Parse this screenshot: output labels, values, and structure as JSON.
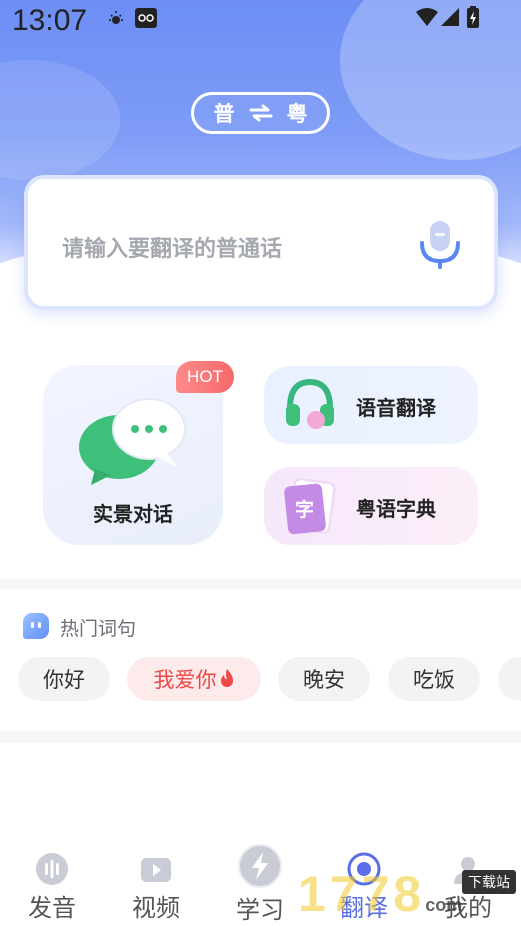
{
  "status_bar": {
    "time": "13:07"
  },
  "header": {
    "lang_from": "普",
    "lang_to": "粤",
    "swap_icon": "swap-arrows-icon"
  },
  "input": {
    "placeholder": "请输入要翻译的普通话",
    "mic_icon": "microphone-icon"
  },
  "features": {
    "scene_dialog": "实景对话",
    "hot_badge": "HOT",
    "voice_translate": "语音翻译",
    "cantonese_dict": "粤语字典",
    "dict_glyph": "字"
  },
  "hot_phrases": {
    "title": "热门词句",
    "items": [
      "你好",
      "我爱你",
      "晚安",
      "吃饭"
    ]
  },
  "nav": {
    "items": [
      "发音",
      "视频",
      "学习",
      "翻译",
      "我的"
    ],
    "active": "翻译"
  },
  "watermark": {
    "text": "1778",
    "site": "下载站",
    "domain": "com"
  },
  "colors": {
    "accent": "#5a6ee8",
    "hero": "#7e9cf7",
    "hot": "#f04848"
  }
}
